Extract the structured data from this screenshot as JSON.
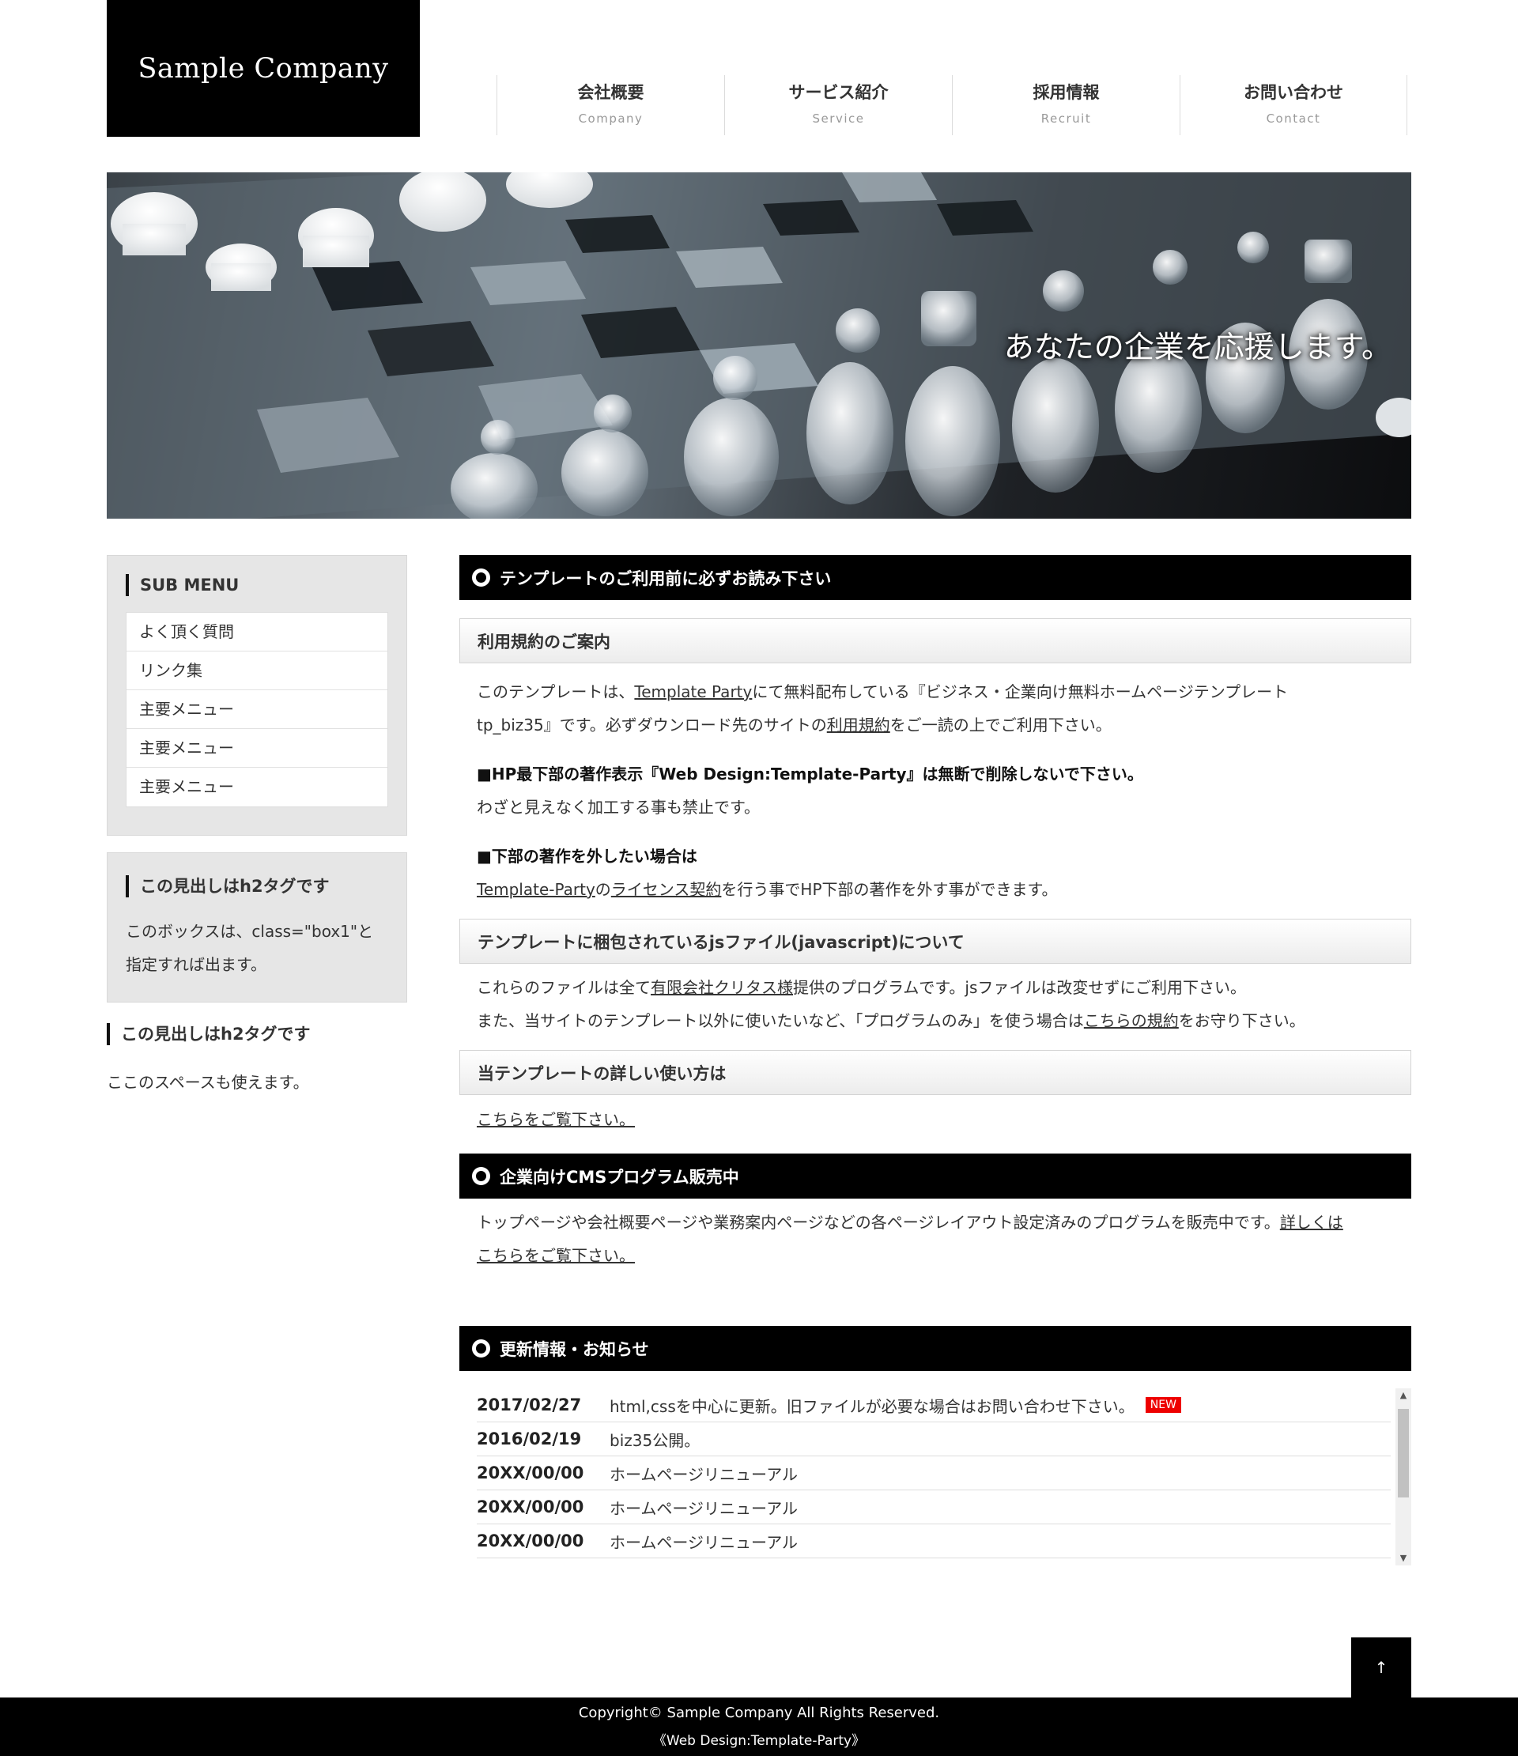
{
  "header": {
    "logo": "Sample Company",
    "nav": [
      {
        "jp": "会社概要",
        "en": "Company"
      },
      {
        "jp": "サービス紹介",
        "en": "Service"
      },
      {
        "jp": "採用情報",
        "en": "Recruit"
      },
      {
        "jp": "お問い合わせ",
        "en": "Contact"
      }
    ]
  },
  "hero": {
    "catch": "あなたの企業を応援します。"
  },
  "sidebar": {
    "submenu_title": "SUB MENU",
    "submenu": [
      "よく頂く質問",
      "リンク集",
      "主要メニュー",
      "主要メニュー",
      "主要メニュー"
    ],
    "box1_title": "この見出しはh2タグです",
    "box1_text_1": "このボックスは、class=\"box1\"と",
    "box1_text_2": "指定すれば出ます。",
    "plain_title": "この見出しはh2タグです",
    "plain_text": "ここのスペースも使えます。"
  },
  "main": {
    "sec1_title": "テンプレートのご利用前に必ずお読み下さい",
    "terms_title": "利用規約のご案内",
    "terms_p1_a": "このテンプレートは、",
    "terms_p1_link": "Template Party",
    "terms_p1_b": "にて無料配布している『ビジネス・企業向け無料ホームページテンプレート",
    "terms_p2_a": "tp_biz35』です。必ずダウンロード先のサイトの",
    "terms_p2_link": "利用規約",
    "terms_p2_b": "をご一読の上でご利用下さい。",
    "bold1": "■HP最下部の著作表示『Web Design:Template-Party』は無断で削除しないで下さい。",
    "text1": "わざと見えなく加工する事も禁止です。",
    "bold2": "■下部の著作を外したい場合は",
    "text2_link1": "Template-Party",
    "text2_a": "の",
    "text2_link2": "ライセンス契約",
    "text2_b": "を行う事でHP下部の著作を外す事ができます。",
    "js_title": "テンプレートに梱包されているjsファイル(javascript)について",
    "js_p1_a": "これらのファイルは全て",
    "js_p1_link": "有限会社クリタス様",
    "js_p1_b": "提供のプログラムです。jsファイルは改変せずにご利用下さい。",
    "js_p2_a": "また、当サイトのテンプレート以外に使いたいなど、「プログラムのみ」を使う場合は",
    "js_p2_link": "こちらの規約",
    "js_p2_b": "をお守り下さい。",
    "howto_title": "当テンプレートの詳しい使い方は",
    "howto_link": "こちらをご覧下さい。",
    "sec2_title": "企業向けCMSプログラム販売中",
    "cms_p_a": "トップページや会社概要ページや業務案内ページなどの各ページレイアウト設定済みのプログラムを販売中です。",
    "cms_p_link1": "詳しくは",
    "cms_p_link2": "こちらをご覧下さい。",
    "news_title": "更新情報・お知らせ",
    "news": [
      {
        "date": "2017/02/27",
        "text": "html,cssを中心に更新。旧ファイルが必要な場合はお問い合わせ下さい。",
        "badge": "NEW"
      },
      {
        "date": "2016/02/19",
        "text": "biz35公開。",
        "badge": ""
      },
      {
        "date": "20XX/00/00",
        "text": "ホームページリニューアル",
        "badge": ""
      },
      {
        "date": "20XX/00/00",
        "text": "ホームページリニューアル",
        "badge": ""
      },
      {
        "date": "20XX/00/00",
        "text": "ホームページリニューアル",
        "badge": ""
      }
    ]
  },
  "pagetop": "↑",
  "footer": {
    "copyright": "Copyright© Sample Company All Rights Reserved.",
    "credit": "《Web Design:Template-Party》"
  }
}
